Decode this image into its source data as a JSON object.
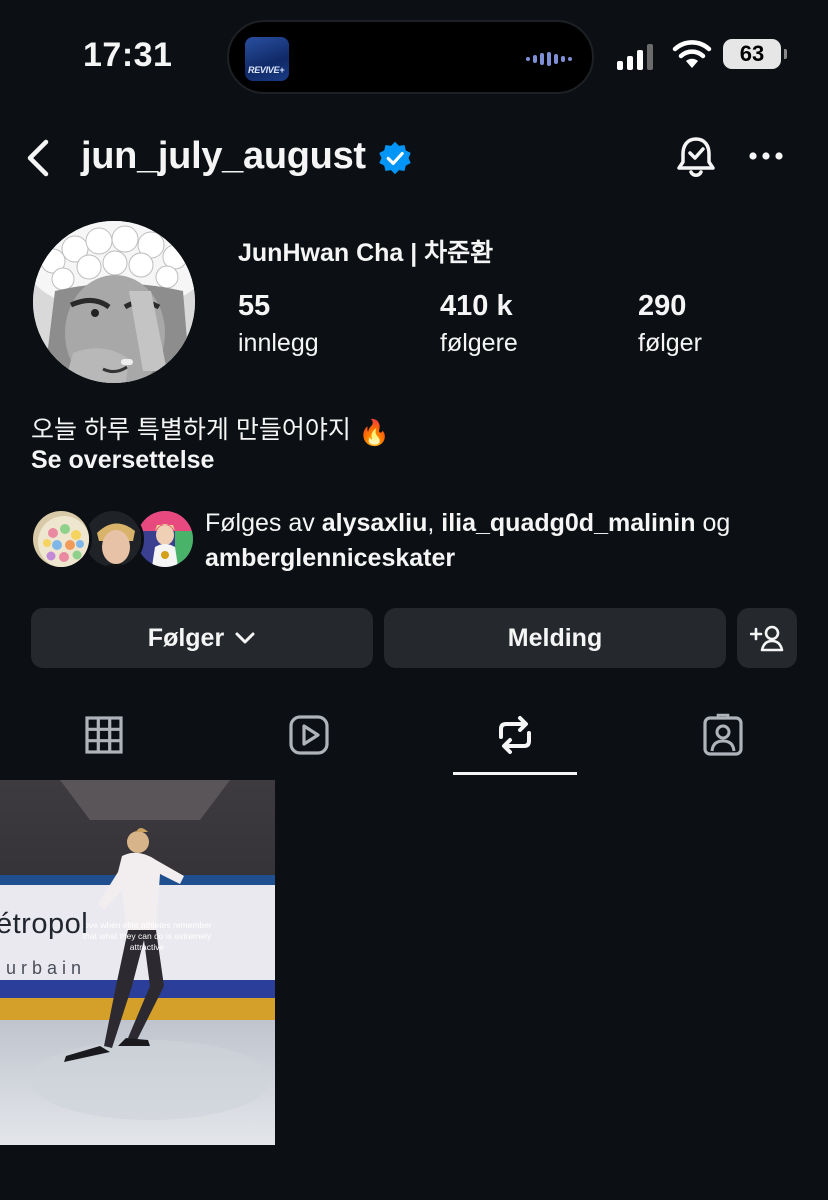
{
  "status_bar": {
    "time": "17:31",
    "battery": "63",
    "now_playing_art_text": "REVIVE+"
  },
  "header": {
    "username": "jun_july_august",
    "icons": [
      "back-icon",
      "verified-badge-icon",
      "notification-bell-icon",
      "more-options-icon"
    ]
  },
  "profile": {
    "display_name": "JunHwan Cha | 차준환",
    "stats": [
      {
        "value": "55",
        "label": "innlegg"
      },
      {
        "value": "410 k",
        "label": "følgere"
      },
      {
        "value": "290",
        "label": "følger"
      }
    ],
    "bio": "오늘 하루 특별하게 만들어야지",
    "bio_emoji": "🔥",
    "translate_link": "Se oversettelse"
  },
  "followed_by": {
    "prefix": "Følges av",
    "user1": "alysaxliu",
    "separator": ",",
    "user2": "ilia_quadg0d_malinin",
    "conjunction": "og",
    "user3": "amberglenniceskater"
  },
  "actions": {
    "follow_label": "Følger",
    "message_label": "Melding",
    "suggest_icon": "add-person-icon"
  },
  "tabs": {
    "items": [
      "grid-icon",
      "reels-icon",
      "reposts-icon",
      "tagged-icon"
    ],
    "active": "reposts-icon"
  },
  "posts": [
    {
      "caption": "love when elite athletes remember that what they can do is extremely attractive",
      "banner_text_1": "étropol",
      "banner_text_2": "urbain"
    }
  ],
  "colors": {
    "background": "#0c1014",
    "button": "#25292e",
    "verified": "#0095f6",
    "text": "#f5f5f5"
  }
}
